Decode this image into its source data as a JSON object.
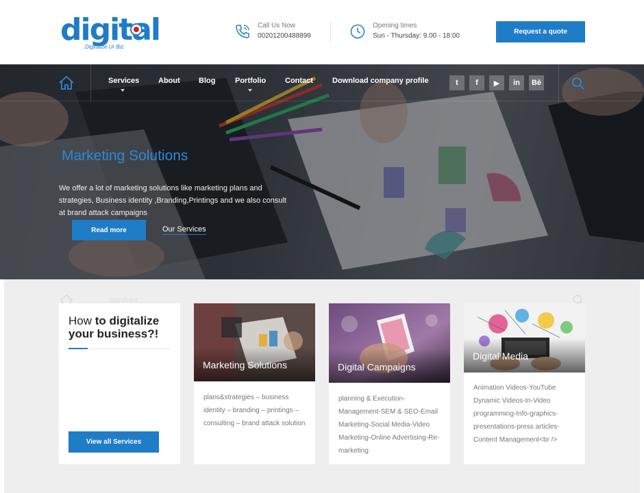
{
  "header": {
    "logo_text": "digital",
    "logo_tagline": "Digitalize Ur Biz",
    "call": {
      "label": "Call Us Now",
      "value": "00201200488899",
      "icon": "phone-icon"
    },
    "hours": {
      "label": "Opening times",
      "value": "Sun - Thursday: 9.00 - 18:00",
      "icon": "clock-icon"
    },
    "quote_button": "Request a quote"
  },
  "nav": {
    "items": [
      "Services",
      "About",
      "Blog",
      "Portfolio",
      "Contact",
      "Download company profile"
    ],
    "social": [
      {
        "name": "twitter-icon",
        "glyph": "t"
      },
      {
        "name": "facebook-icon",
        "glyph": "f"
      },
      {
        "name": "youtube-icon",
        "glyph": "▶"
      },
      {
        "name": "linkedin-icon",
        "glyph": "in"
      },
      {
        "name": "behance-icon",
        "glyph": "Bē"
      }
    ]
  },
  "hero": {
    "title": "Marketing Solutions",
    "text": "We offer a lot of marketing solutions like marketing plans and strategies, Business identity ,Branding,Printings and we also consult at brand attack campaigns",
    "primary_button": "Read more",
    "secondary_link": "Our Services"
  },
  "intro": {
    "title_plain": "How ",
    "title_bold": "to digitalize your business?!",
    "button": "View all Services"
  },
  "services": [
    {
      "title": "Marketing Solutions",
      "description": "plans&strategies – business identity – branding – printings – consulting – brand attack solution"
    },
    {
      "title": "Digital Campaigns",
      "description": "planning & Execution-Management-SEM & SEO-Email Marketing-Social Media-Video Marketing-Online Advertising-Re-marketing"
    },
    {
      "title": "Digital Media",
      "description": "Animation Videos-YouTube Dynamic Videos-In-Video programming-Info-graphics-presentations-press articles-Content Management<br />"
    }
  ],
  "colors": {
    "accent": "#1f7cc7",
    "logo_red": "#d2202f",
    "content_bg": "#eeeeee"
  }
}
